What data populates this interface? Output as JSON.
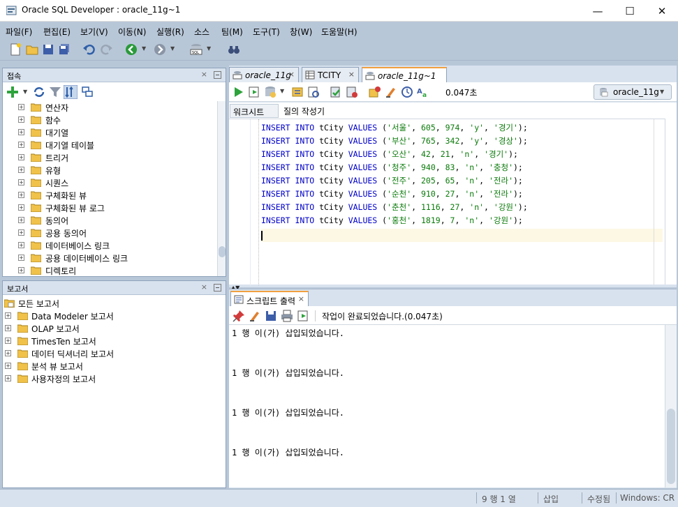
{
  "window": {
    "title": "Oracle SQL Developer : oracle_11g~1"
  },
  "menu": [
    "파일(F)",
    "편집(E)",
    "보기(V)",
    "이동(N)",
    "실행(R)",
    "소스",
    "팀(M)",
    "도구(T)",
    "창(W)",
    "도움말(H)"
  ],
  "connections": {
    "title": "접속",
    "items": [
      "연산자",
      "함수",
      "대기열",
      "대기열 테이블",
      "트리거",
      "유형",
      "시퀀스",
      "구체화된 뷰",
      "구체화된 뷰 로그",
      "동의어",
      "공용 동의어",
      "데이터베이스 링크",
      "공용 데이터베이스 링크",
      "디렉토리"
    ]
  },
  "reports": {
    "title": "보고서",
    "root": "모든 보고서",
    "items": [
      "Data Modeler 보고서",
      "OLAP 보고서",
      "TimesTen 보고서",
      "데이터 딕셔너리 보고서",
      "분석 뷰 보고서",
      "사용자정의 보고서"
    ]
  },
  "editor": {
    "tabs": [
      "oracle_11g",
      "TCITY",
      "oracle_11g~1"
    ],
    "elapsed": "0.047초",
    "connection": "oracle_11g",
    "subtabs": [
      "워크시트",
      "질의 작성기"
    ],
    "lines": [
      [
        "'서울'",
        "605",
        "974",
        "'y'",
        "'경기'"
      ],
      [
        "'부산'",
        "765",
        "342",
        "'y'",
        "'경상'"
      ],
      [
        "'오산'",
        "42",
        "21",
        "'n'",
        "'경기'"
      ],
      [
        "'청주'",
        "940",
        "83",
        "'n'",
        "'충청'"
      ],
      [
        "'전주'",
        "205",
        "65",
        "'n'",
        "'전라'"
      ],
      [
        "'순천'",
        "910",
        "27",
        "'n'",
        "'전라'"
      ],
      [
        "'춘천'",
        "1116",
        "27",
        "'n'",
        "'강원'"
      ],
      [
        "'홍천'",
        "1819",
        "7",
        "'n'",
        "'강원'"
      ]
    ],
    "kw_insert": "INSERT",
    "kw_into": "INTO",
    "table": "tCity",
    "kw_values": "VALUES"
  },
  "output": {
    "tab": "스크립트 출력",
    "message": "작업이 완료되었습니다.(0.047초)",
    "lines": [
      "1 행 이(가) 삽입되었습니다.",
      "1 행 이(가) 삽입되었습니다.",
      "1 행 이(가) 삽입되었습니다.",
      "1 행 이(가) 삽입되었습니다."
    ]
  },
  "status": {
    "position": "9 행 1 열",
    "mode": "삽입",
    "modified": "수정됨",
    "lineend": "Windows: CR"
  }
}
